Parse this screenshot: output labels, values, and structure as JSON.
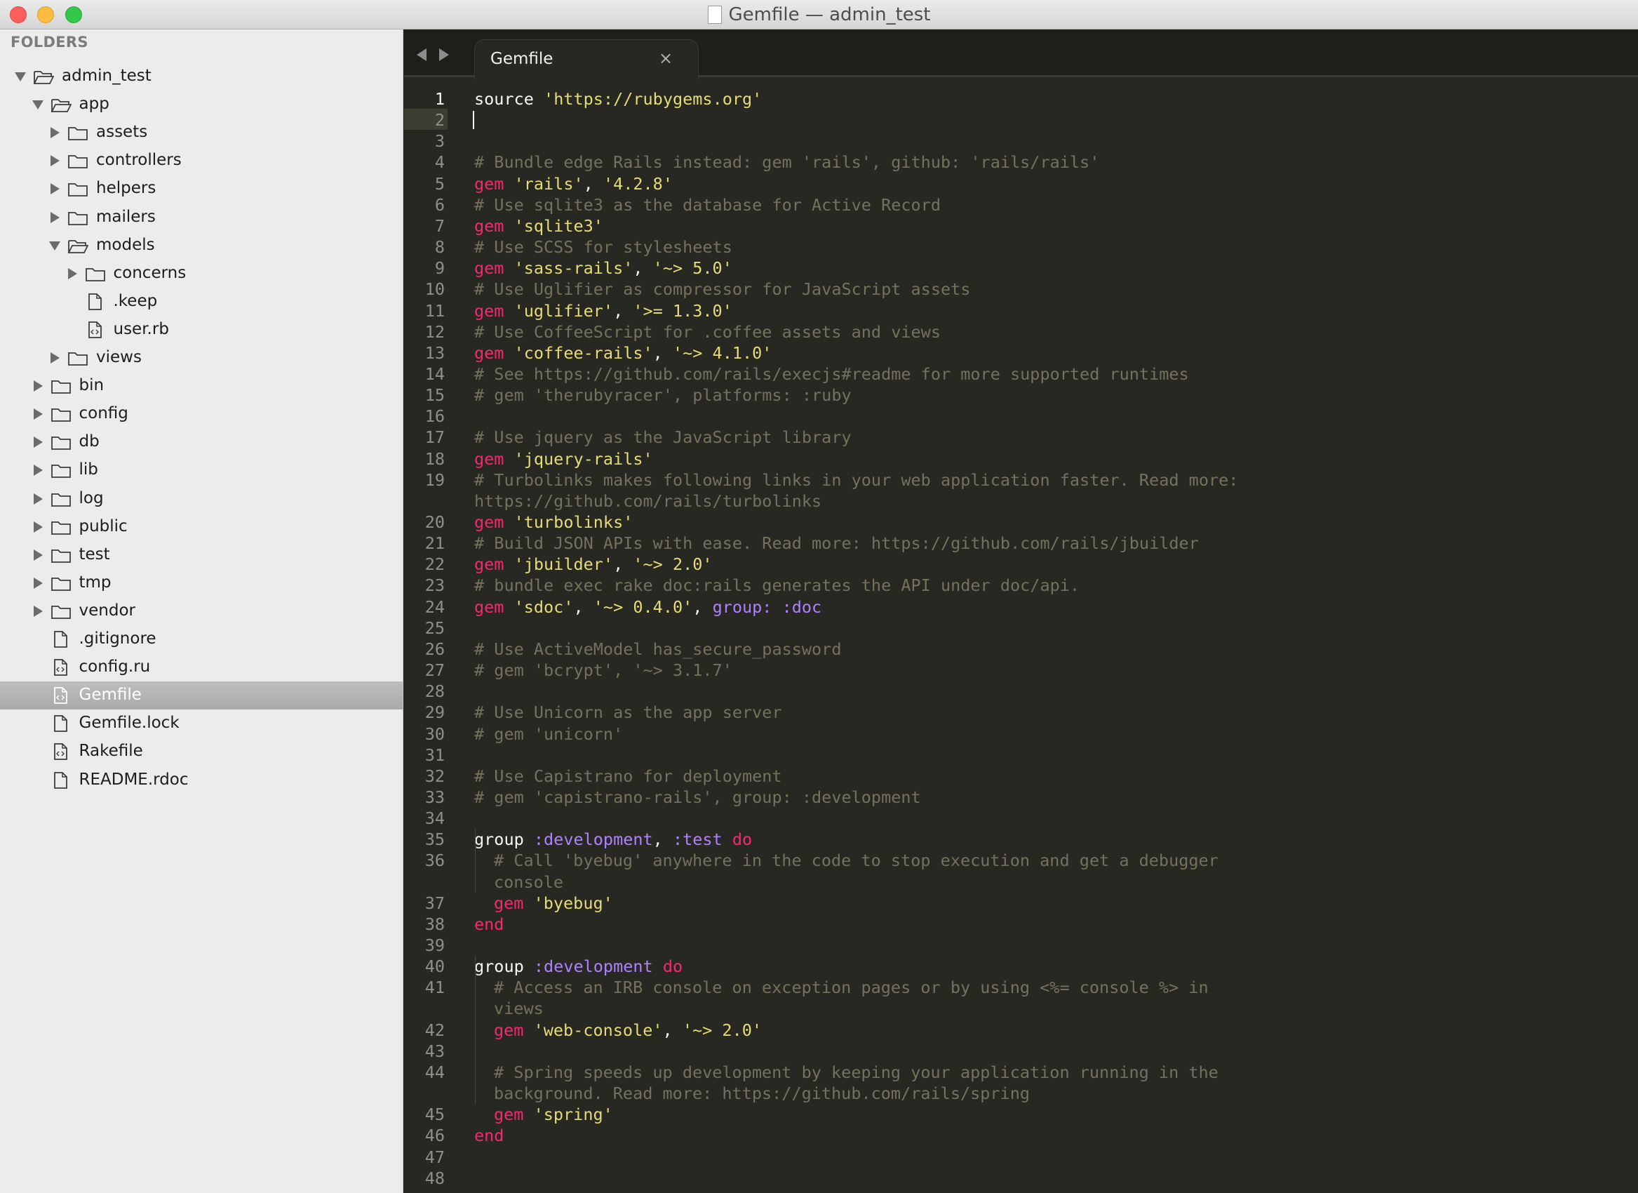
{
  "window": {
    "title": "Gemfile — admin_test"
  },
  "sidebar": {
    "heading": "FOLDERS",
    "items": [
      {
        "label": "admin_test",
        "depth": 0,
        "kind": "folder-open",
        "arrow": "down"
      },
      {
        "label": "app",
        "depth": 1,
        "kind": "folder-open",
        "arrow": "down"
      },
      {
        "label": "assets",
        "depth": 2,
        "kind": "folder",
        "arrow": "right"
      },
      {
        "label": "controllers",
        "depth": 2,
        "kind": "folder",
        "arrow": "right"
      },
      {
        "label": "helpers",
        "depth": 2,
        "kind": "folder",
        "arrow": "right"
      },
      {
        "label": "mailers",
        "depth": 2,
        "kind": "folder",
        "arrow": "right"
      },
      {
        "label": "models",
        "depth": 2,
        "kind": "folder-open",
        "arrow": "down"
      },
      {
        "label": "concerns",
        "depth": 3,
        "kind": "folder",
        "arrow": "right"
      },
      {
        "label": ".keep",
        "depth": 3,
        "kind": "file",
        "arrow": ""
      },
      {
        "label": "user.rb",
        "depth": 3,
        "kind": "code-file",
        "arrow": ""
      },
      {
        "label": "views",
        "depth": 2,
        "kind": "folder",
        "arrow": "right"
      },
      {
        "label": "bin",
        "depth": 1,
        "kind": "folder",
        "arrow": "right"
      },
      {
        "label": "config",
        "depth": 1,
        "kind": "folder",
        "arrow": "right"
      },
      {
        "label": "db",
        "depth": 1,
        "kind": "folder",
        "arrow": "right"
      },
      {
        "label": "lib",
        "depth": 1,
        "kind": "folder",
        "arrow": "right"
      },
      {
        "label": "log",
        "depth": 1,
        "kind": "folder",
        "arrow": "right"
      },
      {
        "label": "public",
        "depth": 1,
        "kind": "folder",
        "arrow": "right"
      },
      {
        "label": "test",
        "depth": 1,
        "kind": "folder",
        "arrow": "right"
      },
      {
        "label": "tmp",
        "depth": 1,
        "kind": "folder",
        "arrow": "right"
      },
      {
        "label": "vendor",
        "depth": 1,
        "kind": "folder",
        "arrow": "right"
      },
      {
        "label": ".gitignore",
        "depth": 1,
        "kind": "file",
        "arrow": ""
      },
      {
        "label": "config.ru",
        "depth": 1,
        "kind": "code-file",
        "arrow": ""
      },
      {
        "label": "Gemfile",
        "depth": 1,
        "kind": "code-file",
        "arrow": "",
        "selected": true
      },
      {
        "label": "Gemfile.lock",
        "depth": 1,
        "kind": "file",
        "arrow": ""
      },
      {
        "label": "Rakefile",
        "depth": 1,
        "kind": "code-file",
        "arrow": ""
      },
      {
        "label": "README.rdoc",
        "depth": 1,
        "kind": "file",
        "arrow": ""
      }
    ]
  },
  "editor": {
    "tab_label": "Gemfile",
    "tab_close": "×",
    "active_line": 1,
    "colors": {
      "background": "#272822",
      "comment": "#75715e",
      "keyword": "#f92672",
      "string": "#e6db74",
      "symbol": "#ae81ff",
      "plain": "#f8f8f2"
    },
    "lines": [
      {
        "n": "1",
        "tokens": [
          [
            "plain",
            "source "
          ],
          [
            "str",
            "'https://rubygems.org'"
          ]
        ]
      },
      {
        "n": "2",
        "tokens": []
      },
      {
        "n": "3",
        "tokens": []
      },
      {
        "n": "4",
        "tokens": [
          [
            "com",
            "# Bundle edge Rails instead: gem 'rails', github: 'rails/rails'"
          ]
        ]
      },
      {
        "n": "5",
        "tokens": [
          [
            "kw",
            "gem "
          ],
          [
            "str",
            "'rails'"
          ],
          [
            "plain",
            ", "
          ],
          [
            "str",
            "'4.2.8'"
          ]
        ]
      },
      {
        "n": "6",
        "tokens": [
          [
            "com",
            "# Use sqlite3 as the database for Active Record"
          ]
        ]
      },
      {
        "n": "7",
        "tokens": [
          [
            "kw",
            "gem "
          ],
          [
            "str",
            "'sqlite3'"
          ]
        ]
      },
      {
        "n": "8",
        "tokens": [
          [
            "com",
            "# Use SCSS for stylesheets"
          ]
        ]
      },
      {
        "n": "9",
        "tokens": [
          [
            "kw",
            "gem "
          ],
          [
            "str",
            "'sass-rails'"
          ],
          [
            "plain",
            ", "
          ],
          [
            "str",
            "'~> 5.0'"
          ]
        ]
      },
      {
        "n": "10",
        "tokens": [
          [
            "com",
            "# Use Uglifier as compressor for JavaScript assets"
          ]
        ]
      },
      {
        "n": "11",
        "tokens": [
          [
            "kw",
            "gem "
          ],
          [
            "str",
            "'uglifier'"
          ],
          [
            "plain",
            ", "
          ],
          [
            "str",
            "'>= 1.3.0'"
          ]
        ]
      },
      {
        "n": "12",
        "tokens": [
          [
            "com",
            "# Use CoffeeScript for .coffee assets and views"
          ]
        ]
      },
      {
        "n": "13",
        "tokens": [
          [
            "kw",
            "gem "
          ],
          [
            "str",
            "'coffee-rails'"
          ],
          [
            "plain",
            ", "
          ],
          [
            "str",
            "'~> 4.1.0'"
          ]
        ]
      },
      {
        "n": "14",
        "tokens": [
          [
            "com",
            "# See https://github.com/rails/execjs#readme for more supported runtimes"
          ]
        ]
      },
      {
        "n": "15",
        "tokens": [
          [
            "com",
            "# gem 'therubyracer', platforms: :ruby"
          ]
        ]
      },
      {
        "n": "16",
        "tokens": []
      },
      {
        "n": "17",
        "tokens": [
          [
            "com",
            "# Use jquery as the JavaScript library"
          ]
        ]
      },
      {
        "n": "18",
        "tokens": [
          [
            "kw",
            "gem "
          ],
          [
            "str",
            "'jquery-rails'"
          ]
        ]
      },
      {
        "n": "19",
        "tokens": [
          [
            "com",
            "# Turbolinks makes following links in your web application faster. Read more:"
          ]
        ]
      },
      {
        "n": "",
        "tokens": [
          [
            "com",
            "https://github.com/rails/turbolinks"
          ]
        ]
      },
      {
        "n": "20",
        "tokens": [
          [
            "kw",
            "gem "
          ],
          [
            "str",
            "'turbolinks'"
          ]
        ]
      },
      {
        "n": "21",
        "tokens": [
          [
            "com",
            "# Build JSON APIs with ease. Read more: https://github.com/rails/jbuilder"
          ]
        ]
      },
      {
        "n": "22",
        "tokens": [
          [
            "kw",
            "gem "
          ],
          [
            "str",
            "'jbuilder'"
          ],
          [
            "plain",
            ", "
          ],
          [
            "str",
            "'~> 2.0'"
          ]
        ]
      },
      {
        "n": "23",
        "tokens": [
          [
            "com",
            "# bundle exec rake doc:rails generates the API under doc/api."
          ]
        ]
      },
      {
        "n": "24",
        "tokens": [
          [
            "kw",
            "gem "
          ],
          [
            "str",
            "'sdoc'"
          ],
          [
            "plain",
            ", "
          ],
          [
            "str",
            "'~> 0.4.0'"
          ],
          [
            "plain",
            ", "
          ],
          [
            "sym",
            "group: :doc"
          ]
        ]
      },
      {
        "n": "25",
        "tokens": []
      },
      {
        "n": "26",
        "tokens": [
          [
            "com",
            "# Use ActiveModel has_secure_password"
          ]
        ]
      },
      {
        "n": "27",
        "tokens": [
          [
            "com",
            "# gem 'bcrypt', '~> 3.1.7'"
          ]
        ]
      },
      {
        "n": "28",
        "tokens": []
      },
      {
        "n": "29",
        "tokens": [
          [
            "com",
            "# Use Unicorn as the app server"
          ]
        ]
      },
      {
        "n": "30",
        "tokens": [
          [
            "com",
            "# gem 'unicorn'"
          ]
        ]
      },
      {
        "n": "31",
        "tokens": []
      },
      {
        "n": "32",
        "tokens": [
          [
            "com",
            "# Use Capistrano for deployment"
          ]
        ]
      },
      {
        "n": "33",
        "tokens": [
          [
            "com",
            "# gem 'capistrano-rails', group: :development"
          ]
        ]
      },
      {
        "n": "34",
        "tokens": []
      },
      {
        "n": "35",
        "tokens": [
          [
            "plain",
            "group "
          ],
          [
            "sym",
            ":development"
          ],
          [
            "plain",
            ", "
          ],
          [
            "sym",
            ":test "
          ],
          [
            "kw",
            "do"
          ]
        ]
      },
      {
        "n": "36",
        "indent": true,
        "tokens": [
          [
            "com",
            "# Call 'byebug' anywhere in the code to stop execution and get a debugger"
          ]
        ]
      },
      {
        "n": "",
        "indent": true,
        "tokens": [
          [
            "com",
            "console"
          ]
        ]
      },
      {
        "n": "37",
        "indent": true,
        "tokens": [
          [
            "kw",
            "gem "
          ],
          [
            "str",
            "'byebug'"
          ]
        ]
      },
      {
        "n": "38",
        "tokens": [
          [
            "kw",
            "end"
          ]
        ]
      },
      {
        "n": "39",
        "tokens": []
      },
      {
        "n": "40",
        "tokens": [
          [
            "plain",
            "group "
          ],
          [
            "sym",
            ":development "
          ],
          [
            "kw",
            "do"
          ]
        ]
      },
      {
        "n": "41",
        "indent": true,
        "tokens": [
          [
            "com",
            "# Access an IRB console on exception pages or by using <%= console %> in"
          ]
        ]
      },
      {
        "n": "",
        "indent": true,
        "tokens": [
          [
            "com",
            "views"
          ]
        ]
      },
      {
        "n": "42",
        "indent": true,
        "tokens": [
          [
            "kw",
            "gem "
          ],
          [
            "str",
            "'web-console'"
          ],
          [
            "plain",
            ", "
          ],
          [
            "str",
            "'~> 2.0'"
          ]
        ]
      },
      {
        "n": "43",
        "tokens": []
      },
      {
        "n": "44",
        "indent": true,
        "tokens": [
          [
            "com",
            "# Spring speeds up development by keeping your application running in the"
          ]
        ]
      },
      {
        "n": "",
        "indent": true,
        "tokens": [
          [
            "com",
            "background. Read more: https://github.com/rails/spring"
          ]
        ]
      },
      {
        "n": "45",
        "indent": true,
        "tokens": [
          [
            "kw",
            "gem "
          ],
          [
            "str",
            "'spring'"
          ]
        ]
      },
      {
        "n": "46",
        "tokens": [
          [
            "kw",
            "end"
          ]
        ]
      },
      {
        "n": "47",
        "tokens": []
      },
      {
        "n": "48",
        "tokens": []
      }
    ]
  }
}
